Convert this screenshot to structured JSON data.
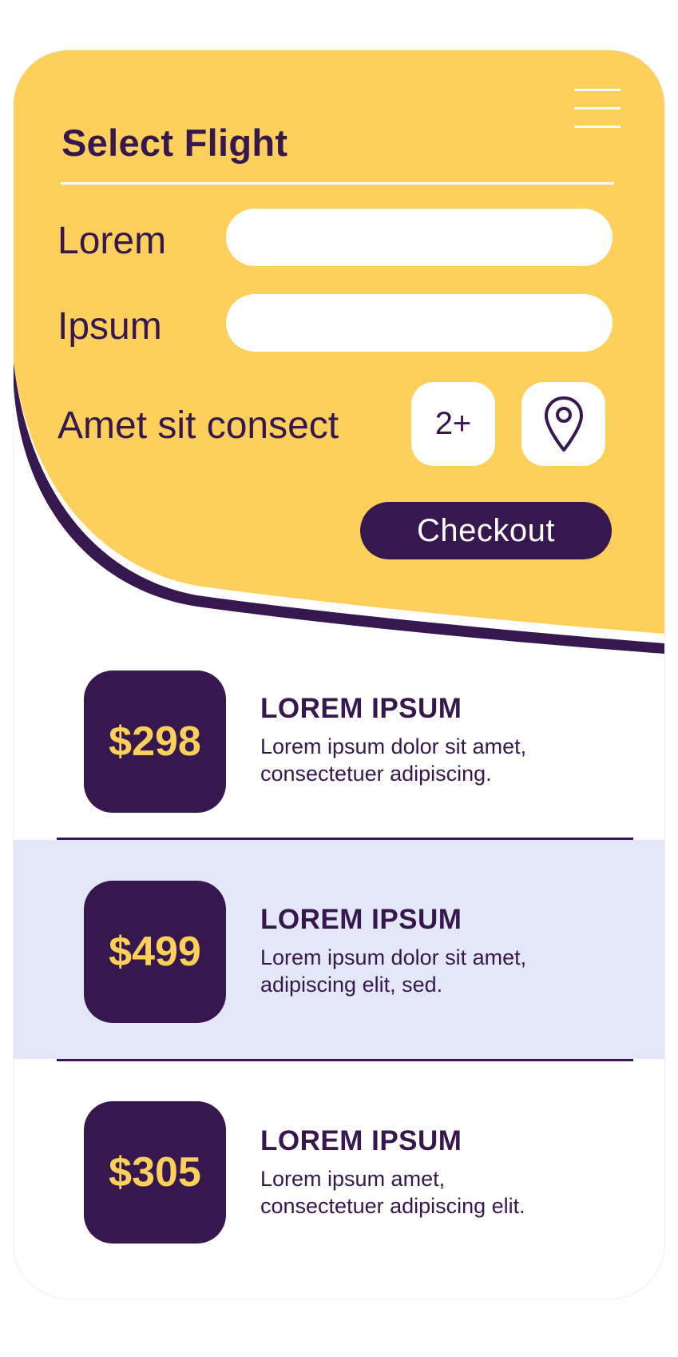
{
  "header": {
    "title": "Select Flight",
    "menu_icon": "hamburger-menu-icon",
    "accent_color": "#fdd05c",
    "dark_color": "#36184f"
  },
  "form": {
    "field1_label": "Lorem",
    "field1_value": "",
    "field2_label": "Ipsum",
    "field2_value": "",
    "option_label": "Amet sit consect",
    "passengers_button": "2+",
    "location_icon": "map-pin-icon",
    "checkout_label": "Checkout"
  },
  "flights": [
    {
      "price": "$298",
      "title": "LOREM IPSUM",
      "desc_line1": "Lorem ipsum dolor sit amet,",
      "desc_line2": "consectetuer adipiscing."
    },
    {
      "price": "$499",
      "title": "LOREM IPSUM",
      "desc_line1": "Lorem ipsum dolor sit amet,",
      "desc_line2": "adipiscing elit, sed."
    },
    {
      "price": "$305",
      "title": "LOREM IPSUM",
      "desc_line1": "Lorem ipsum amet,",
      "desc_line2": "consectetuer adipiscing elit."
    }
  ],
  "highlight_color": "#e3e7f7"
}
